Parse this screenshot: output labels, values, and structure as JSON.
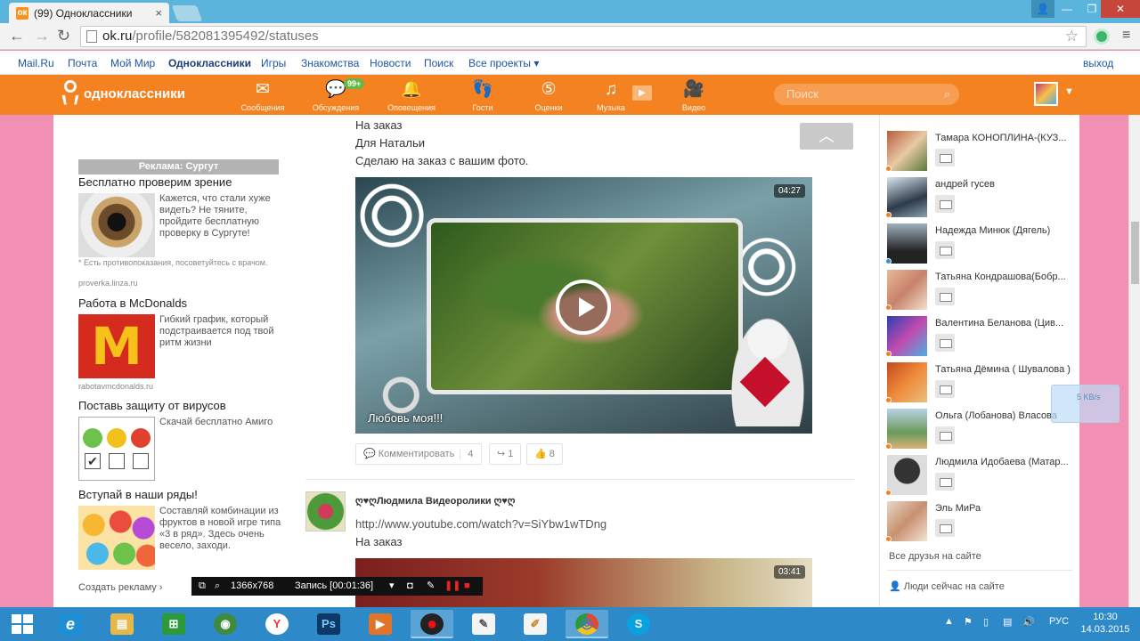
{
  "browser": {
    "tab_title": "(99) Одноклассники",
    "tab_favicon": "ok-favicon",
    "url_host": "ok.ru",
    "url_path": "/profile/582081395492/statuses"
  },
  "mailru_bar": {
    "links": [
      "Mail.Ru",
      "Почта",
      "Мой Мир",
      "Одноклассники",
      "Игры",
      "Знакомства",
      "Новости",
      "Поиск",
      "Все проекты ▾"
    ],
    "logout": "выход"
  },
  "ok_header": {
    "logo_text": "одноклассники",
    "nav": [
      {
        "label": "Сообщения",
        "icon": "envelope-icon",
        "glyph": "✉"
      },
      {
        "label": "Обсуждения",
        "icon": "chat-icon",
        "glyph": "💬",
        "badge": "99+"
      },
      {
        "label": "Оповещения",
        "icon": "bell-icon",
        "glyph": "🔔"
      },
      {
        "label": "Гости",
        "icon": "footprints-icon",
        "glyph": "👣"
      },
      {
        "label": "Оценки",
        "icon": "rating-icon",
        "glyph": "⑤"
      },
      {
        "label": "Музыка",
        "icon": "music-icon",
        "glyph": "♫"
      },
      {
        "label": "Видео",
        "icon": "video-camera-icon",
        "glyph": "🎥"
      }
    ],
    "search_placeholder": "Поиск",
    "accent_color": "#f58220"
  },
  "ads": {
    "header": "Реклама: Сургут",
    "items": [
      {
        "title": "Бесплатно проверим зрение",
        "text": "Кажется, что стали хуже видеть? Не тяните, пройдите бесплатную проверку в Сургуте!",
        "note": "* Есть противопоказания, посоветуйтесь с врачом.",
        "domain": "proverka.linza.ru"
      },
      {
        "title": "Работа в McDonalds",
        "text": "Гибкий график, который подстраивается под твой ритм жизни",
        "image_letter": "M",
        "domain": "rabotavmcdonalds.ru"
      },
      {
        "title": "Поставь защиту от вирусов",
        "text": "Скачай бесплатно Амиго"
      },
      {
        "title": "Вступай в наши ряды!",
        "text": "Составляй комбинации из фруктов в новой игре типа «3 в ряд». Здесь очень весело, заходи."
      }
    ],
    "create_link": "Создать рекламу ›"
  },
  "feed": {
    "post1": {
      "lines": [
        "На заказ",
        "Для Натальи",
        "Сделаю на заказ с вашим фото."
      ],
      "video_duration": "04:27",
      "video_caption": "Любовь моя!!!",
      "actions": {
        "comment_label": "Комментировать",
        "comment_count": "4",
        "share_count": "1",
        "like_count": "8"
      }
    },
    "post2": {
      "author": "ღ♥ღЛюдмила Видеоролики ღ♥ღ",
      "url": "http://www.youtube.com/watch?v=SiYbw1wTDng",
      "line": "На заказ",
      "video_duration": "03:41"
    }
  },
  "friends": {
    "items": [
      {
        "name": "Тамара КОНОПЛИНА-(КУЗ...",
        "status": "orange"
      },
      {
        "name": "андрей гусев",
        "status": "orange"
      },
      {
        "name": "Надежда Минюк (Дягель)",
        "status": "blue"
      },
      {
        "name": "Татьяна Кондрашова(Бобр...",
        "status": "orange"
      },
      {
        "name": "Валентина Беланова (Цив...",
        "status": "orange"
      },
      {
        "name": "Татьяна Дёмина ( Шувалова )",
        "status": "orange"
      },
      {
        "name": "Ольга (Лобанова) Власова",
        "status": "orange"
      },
      {
        "name": "Людмила Идобаева (Матар...",
        "status": "orange"
      },
      {
        "name": "Эль МиРа",
        "status": "orange"
      }
    ],
    "all_friends_link": "Все друзья на сайте",
    "people_online_link": "Люди сейчас на сайте"
  },
  "speed_widget": "5 KB/s",
  "recorder": {
    "resolution": "1366x768",
    "status": "Запись [00:01:36]"
  },
  "taskbar": {
    "apps": [
      {
        "icon": "internet-explorer-icon",
        "glyph": "e",
        "color": "#1e8fd6"
      },
      {
        "icon": "file-explorer-icon",
        "glyph": "▤",
        "color": "#e6b84a"
      },
      {
        "icon": "store-icon",
        "glyph": "⊞",
        "color": "#2c9a3b"
      },
      {
        "icon": "avast-icon",
        "glyph": "◉",
        "color": "#3e8a3e"
      },
      {
        "icon": "yandex-browser-icon",
        "glyph": "Y",
        "color": "#e33"
      },
      {
        "icon": "photoshop-icon",
        "glyph": "Ps",
        "color": "#0b3a66"
      },
      {
        "icon": "media-player-icon",
        "glyph": "▶",
        "color": "#e2742a"
      },
      {
        "icon": "screen-recorder-icon",
        "glyph": "●",
        "color": "#c00",
        "active": true
      },
      {
        "icon": "notepad-icon",
        "glyph": "✎",
        "color": "#999"
      },
      {
        "icon": "paint-icon",
        "glyph": "✐",
        "color": "#888"
      },
      {
        "icon": "chrome-icon",
        "glyph": "◎",
        "color": "#e04a2f",
        "active": true
      },
      {
        "icon": "skype-icon",
        "glyph": "S",
        "color": "#0aa1e0"
      }
    ],
    "language": "РУС",
    "time": "10:30",
    "date": "14.03.2015"
  }
}
